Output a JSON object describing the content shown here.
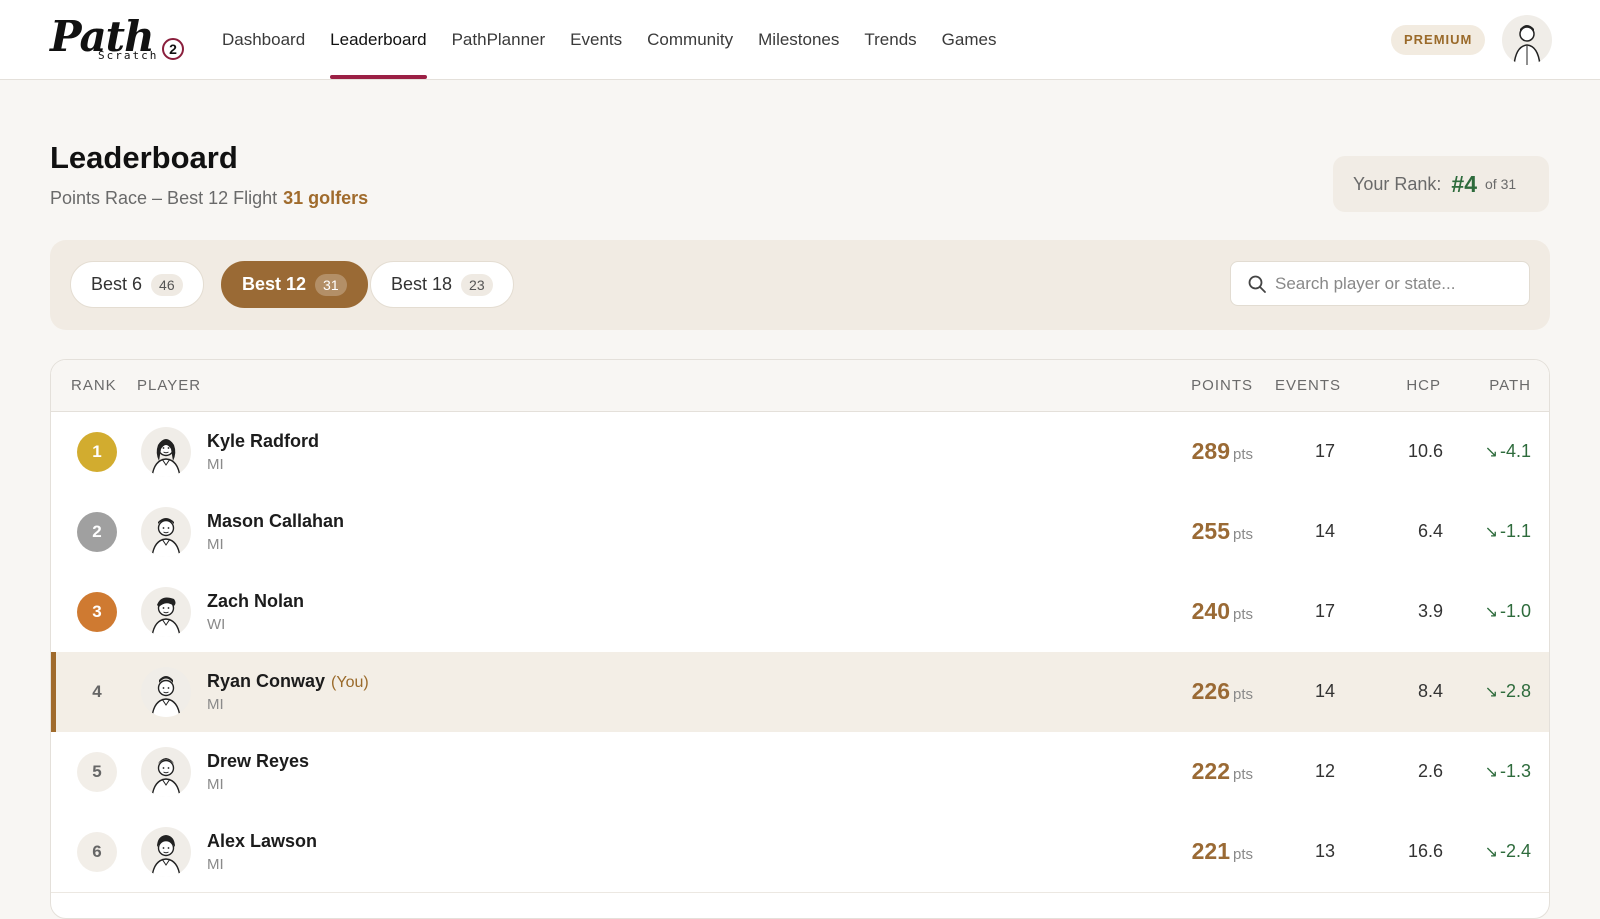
{
  "brand": {
    "name": "Path",
    "sub": "Scratch",
    "badge": "2"
  },
  "nav": [
    {
      "label": "Dashboard",
      "active": false
    },
    {
      "label": "Leaderboard",
      "active": true
    },
    {
      "label": "PathPlanner",
      "active": false
    },
    {
      "label": "Events",
      "active": false
    },
    {
      "label": "Community",
      "active": false
    },
    {
      "label": "Milestones",
      "active": false
    },
    {
      "label": "Trends",
      "active": false
    },
    {
      "label": "Games",
      "active": false
    }
  ],
  "premium_label": "PREMIUM",
  "header": {
    "title": "Leaderboard",
    "subtitle": "Points Race – Best 12 Flight",
    "golfers": "31 golfers"
  },
  "your_rank": {
    "label": "Your Rank:",
    "value": "#4",
    "of": "of 31"
  },
  "filters": [
    {
      "label": "Best 6",
      "count": "46",
      "active": false
    },
    {
      "label": "Best 12",
      "count": "31",
      "active": true
    },
    {
      "label": "Best 18",
      "count": "23",
      "active": false
    }
  ],
  "search": {
    "placeholder": "Search player or state..."
  },
  "table": {
    "headers": {
      "rank": "RANK",
      "player": "PLAYER",
      "points": "POINTS",
      "events": "EVENTS",
      "hcp": "HCP",
      "path": "PATH"
    },
    "points_unit": "pts",
    "you_label": "(You)",
    "rows": [
      {
        "rank": "1",
        "name": "Kyle Radford",
        "state": "MI",
        "points": "289",
        "events": "17",
        "hcp": "10.6",
        "path": "-4.1",
        "medal": "#d2ac2f",
        "you": false
      },
      {
        "rank": "2",
        "name": "Mason Callahan",
        "state": "MI",
        "points": "255",
        "events": "14",
        "hcp": "6.4",
        "path": "-1.1",
        "medal": "#a0a0a0",
        "you": false
      },
      {
        "rank": "3",
        "name": "Zach Nolan",
        "state": "WI",
        "points": "240",
        "events": "17",
        "hcp": "3.9",
        "path": "-1.0",
        "medal": "#cf7a31",
        "you": false
      },
      {
        "rank": "4",
        "name": "Ryan Conway",
        "state": "MI",
        "points": "226",
        "events": "14",
        "hcp": "8.4",
        "path": "-2.8",
        "medal": "",
        "you": true
      },
      {
        "rank": "5",
        "name": "Drew Reyes",
        "state": "MI",
        "points": "222",
        "events": "12",
        "hcp": "2.6",
        "path": "-1.3",
        "medal": "",
        "you": false
      },
      {
        "rank": "6",
        "name": "Alex Lawson",
        "state": "MI",
        "points": "221",
        "events": "13",
        "hcp": "16.6",
        "path": "-2.4",
        "medal": "",
        "you": false
      }
    ]
  },
  "icons": {
    "search": "search-icon",
    "avatar": "avatar-icon",
    "trend": "trend-down-icon"
  },
  "colors": {
    "accent": "#9a6a35",
    "nav_active": "#9b2045",
    "gain": "#2e6b3c"
  }
}
